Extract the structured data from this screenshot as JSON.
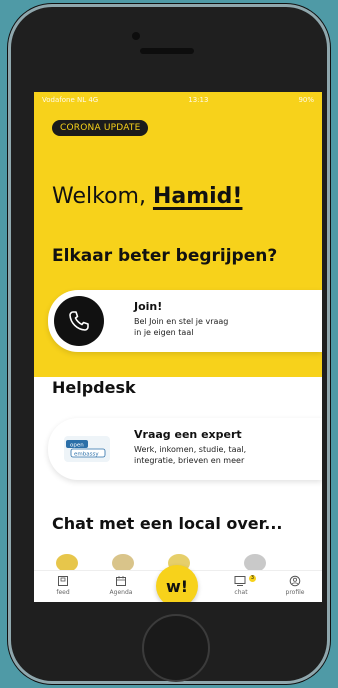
{
  "status": {
    "left": "Vodafone NL 4G",
    "time": "13:13",
    "battery": "90%"
  },
  "badge": "CORONA UPDATE",
  "welcome": {
    "prefix": "Welkom, ",
    "name": "Hamid!"
  },
  "headline": "Elkaar beter begrijpen?",
  "join": {
    "title": "Join!",
    "line1": "Bel Join en stel je vraag",
    "line2": "in je eigen taal"
  },
  "helpdesk": "Helpdesk",
  "expert": {
    "logo_top": "open",
    "logo_bottom": "embassy",
    "title": "Vraag een expert",
    "line1": "Werk, inkomen, studie, taal,",
    "line2": "integratie, brieven en meer"
  },
  "chat_heading": "Chat met een local over...",
  "tabs": {
    "feed": "feed",
    "agenda": "Agenda",
    "center": "w!",
    "chat": "chat",
    "chat_count": "3",
    "profile": "profile"
  },
  "colors": {
    "accent": "#f7d21b",
    "dark": "#111111"
  }
}
